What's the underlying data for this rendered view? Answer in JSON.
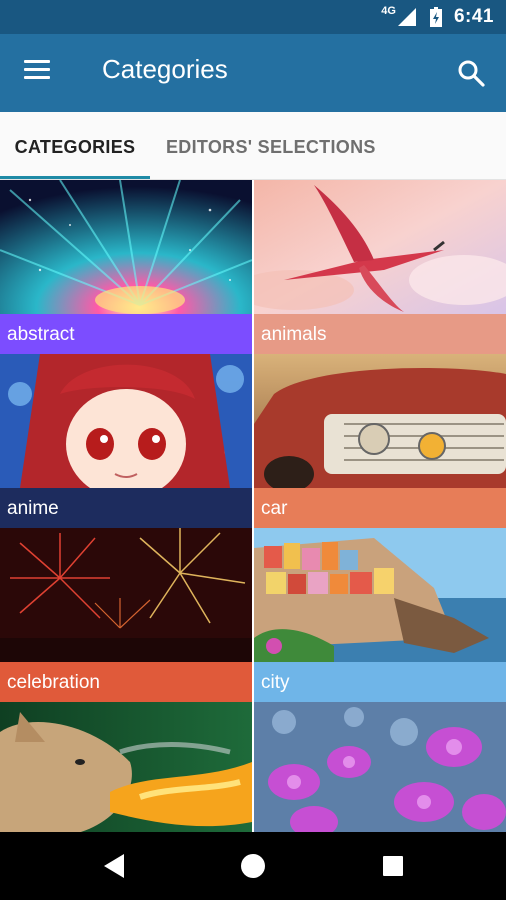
{
  "status_bar": {
    "network": "4G",
    "time": "6:41"
  },
  "app_bar": {
    "title": "Categories"
  },
  "tabs": [
    {
      "label": "CATEGORIES"
    },
    {
      "label": "EDITORS' SELECTIONS"
    }
  ],
  "categories": [
    {
      "label": "abstract",
      "label_color": "#7c4dff"
    },
    {
      "label": "animals",
      "label_color": "#e79a86"
    },
    {
      "label": "anime",
      "label_color": "#1d2c5e"
    },
    {
      "label": "car",
      "label_color": "#e77d58"
    },
    {
      "label": "celebration",
      "label_color": "#e05a3a"
    },
    {
      "label": "city",
      "label_color": "#6fb5e8"
    }
  ],
  "colors": {
    "status_bar": "#195781",
    "app_bar": "#2470a1",
    "tab_indicator": "#1e8aa6"
  }
}
